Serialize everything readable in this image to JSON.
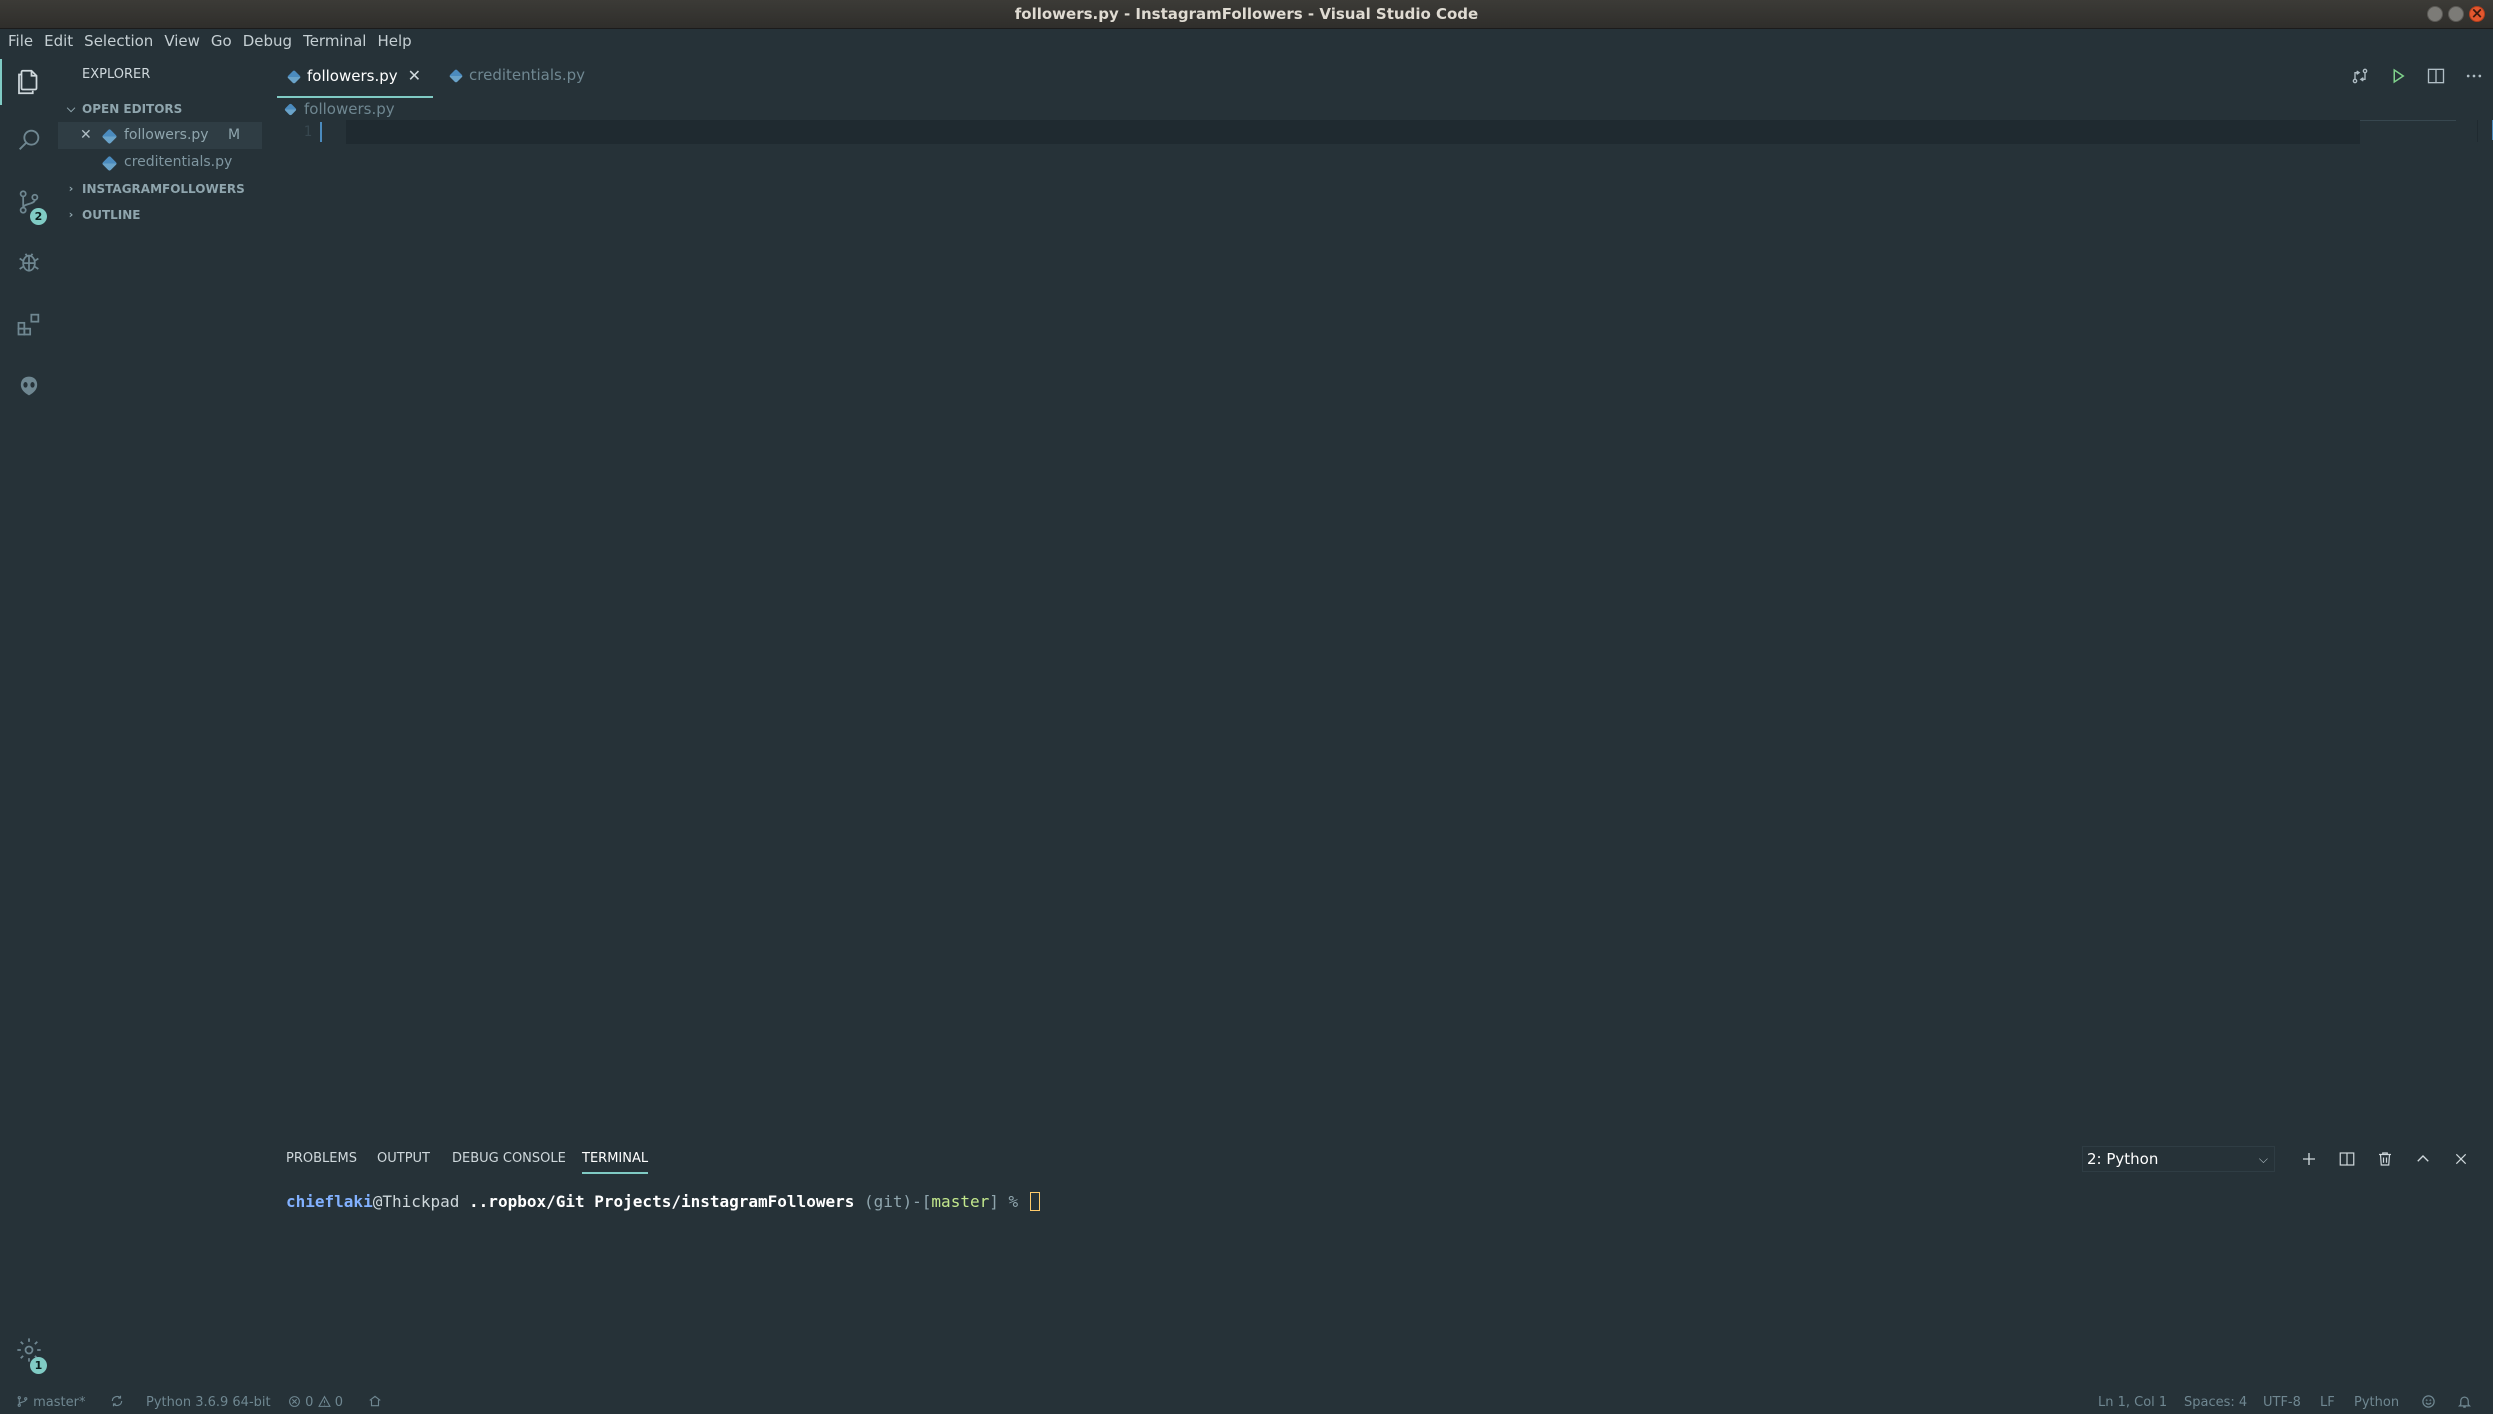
{
  "window": {
    "title": "followers.py - InstagramFollowers - Visual Studio Code"
  },
  "menu": [
    "File",
    "Edit",
    "Selection",
    "View",
    "Go",
    "Debug",
    "Terminal",
    "Help"
  ],
  "activity": {
    "scm_badge": "2",
    "settings_badge": "1"
  },
  "sidebar": {
    "title": "EXPLORER",
    "open_editors_label": "OPEN EDITORS",
    "open_editors": [
      {
        "name": "followers.py",
        "status": "M"
      },
      {
        "name": "creditentials.py",
        "status": ""
      }
    ],
    "project_label": "INSTAGRAMFOLLOWERS",
    "outline_label": "OUTLINE"
  },
  "tabs": [
    {
      "label": "followers.py"
    },
    {
      "label": "creditentials.py"
    }
  ],
  "breadcrumb": "followers.py",
  "editor": {
    "line_number": "1"
  },
  "panel": {
    "tabs": [
      "PROBLEMS",
      "OUTPUT",
      "DEBUG CONSOLE",
      "TERMINAL"
    ],
    "terminal_select": "2: Python",
    "terminal": {
      "user": "chieflaki",
      "host": "@Thickpad",
      "path": " ..ropbox/Git Projects/instagramFollowers",
      "git_open": " (git)-[",
      "branch": "master",
      "git_close": "] % "
    }
  },
  "status": {
    "branch": "master*",
    "interpreter": "Python 3.6.9 64-bit",
    "errors": "0",
    "warnings": "0",
    "position": "Ln 1, Col 1",
    "spaces": "Spaces: 4",
    "encoding": "UTF-8",
    "eol": "LF",
    "language": "Python"
  },
  "colors": {
    "background": "#263238",
    "accent": "#80cbc4",
    "python_blue": "#4b8bbe"
  }
}
